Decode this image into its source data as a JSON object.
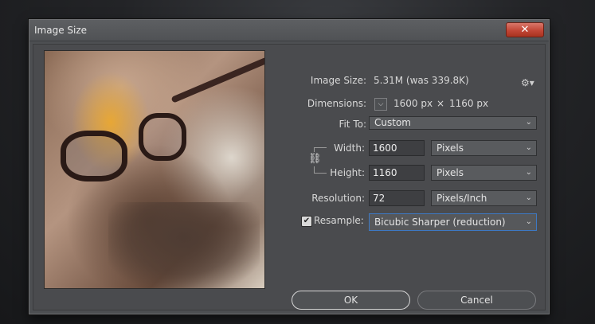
{
  "dialog": {
    "title": "Image Size",
    "close_icon": "close-x-icon",
    "close_glyph": "✕"
  },
  "info": {
    "image_size_label": "Image Size:",
    "image_size_value": "5.31M (was 339.8K)",
    "settings_icon": "gear-icon",
    "settings_glyph": "⚙▾",
    "dimensions_label": "Dimensions:",
    "dimensions_toggle_glyph": "⌵",
    "dimensions_width": "1600 px",
    "dimensions_times": "×",
    "dimensions_height": "1160 px"
  },
  "fit_to": {
    "label": "Fit To:",
    "value": "Custom"
  },
  "width": {
    "label": "Width:",
    "value": "1600",
    "unit": "Pixels"
  },
  "height": {
    "label": "Height:",
    "value": "1160",
    "unit": "Pixels"
  },
  "constrain": {
    "icon": "link-chain-icon",
    "glyph": "⛓"
  },
  "resolution": {
    "label": "Resolution:",
    "value": "72",
    "unit": "Pixels/Inch"
  },
  "resample": {
    "checked": true,
    "check_glyph": "✔",
    "label": "Resample:",
    "value": "Bicubic Sharper (reduction)"
  },
  "buttons": {
    "ok_label": "OK",
    "cancel_label": "Cancel"
  },
  "chevron_glyph": "⌄",
  "colors": {
    "dialog_bg": "#4d4f52",
    "close_red": "#c24636",
    "focus_blue": "#3d79c4"
  }
}
